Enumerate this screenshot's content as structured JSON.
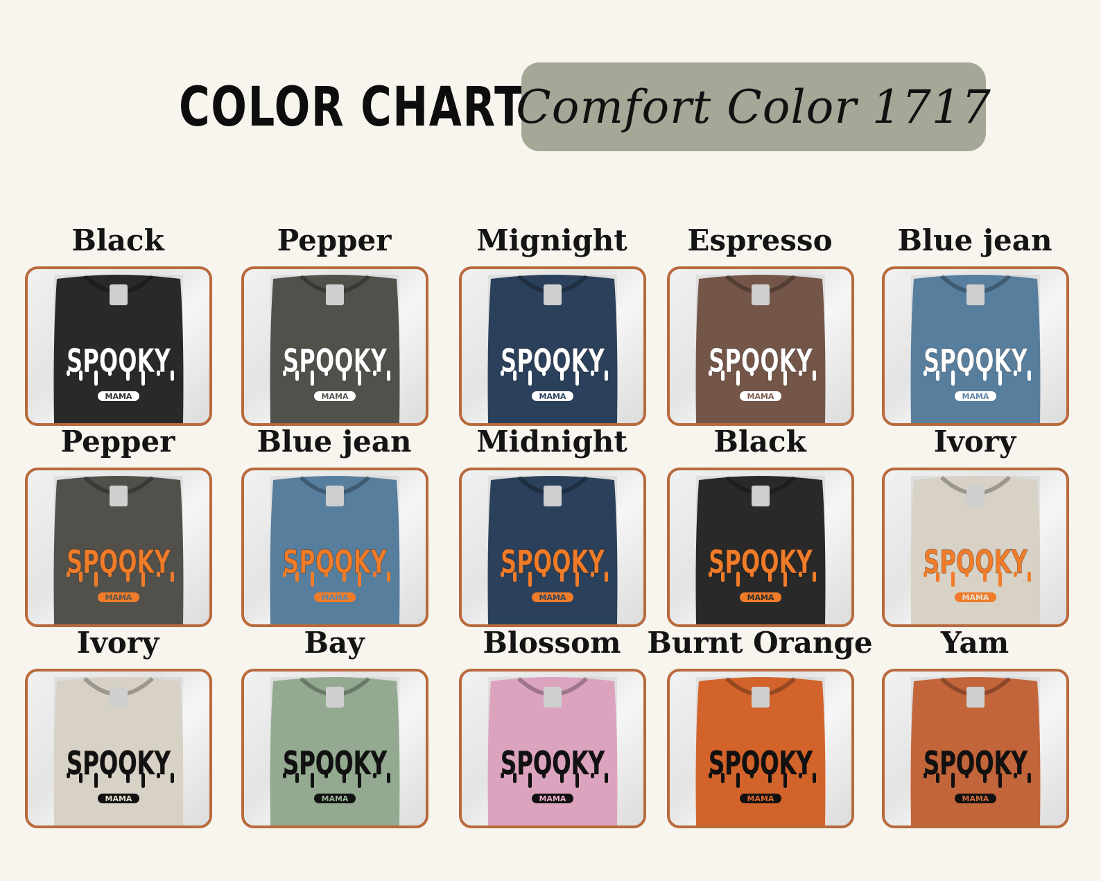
{
  "header": {
    "title": "COLOR CHART",
    "badge": "Comfort Color 1717"
  },
  "design": {
    "main_text": "SPOOKY",
    "sub_text": "MAMA"
  },
  "swatches": [
    {
      "label": "Black",
      "shirt_color": "#2c2c2c",
      "print_color": "#ffffff"
    },
    {
      "label": "Pepper",
      "shirt_color": "#575650",
      "print_color": "#ffffff"
    },
    {
      "label": "Mignight",
      "shirt_color": "#2e4560",
      "print_color": "#ffffff"
    },
    {
      "label": "Espresso",
      "shirt_color": "#7c5c4e",
      "print_color": "#ffffff"
    },
    {
      "label": "Blue jean",
      "shirt_color": "#5e86a8",
      "print_color": "#ffffff"
    },
    {
      "label": "Pepper",
      "shirt_color": "#575650",
      "print_color": "#f07c2a"
    },
    {
      "label": "Blue jean",
      "shirt_color": "#5e86a8",
      "print_color": "#f07c2a"
    },
    {
      "label": "Midnight",
      "shirt_color": "#2e4560",
      "print_color": "#f07c2a"
    },
    {
      "label": "Black",
      "shirt_color": "#2c2c2c",
      "print_color": "#f07c2a"
    },
    {
      "label": "Ivory",
      "shirt_color": "#e6dfd2",
      "print_color": "#f07c2a"
    },
    {
      "label": "Ivory",
      "shirt_color": "#e6dfd2",
      "print_color": "#111111"
    },
    {
      "label": "Bay",
      "shirt_color": "#9db59a",
      "print_color": "#111111"
    },
    {
      "label": "Blossom",
      "shirt_color": "#eaaecb",
      "print_color": "#111111"
    },
    {
      "label": "Burnt Orange",
      "shirt_color": "#e06a2e",
      "print_color": "#111111"
    },
    {
      "label": "Yam",
      "shirt_color": "#cf6c3e",
      "print_color": "#111111"
    }
  ],
  "colors": {
    "background": "#f8f4ee",
    "frame_border": "#b86a3c",
    "badge_background": "#a5a897"
  }
}
